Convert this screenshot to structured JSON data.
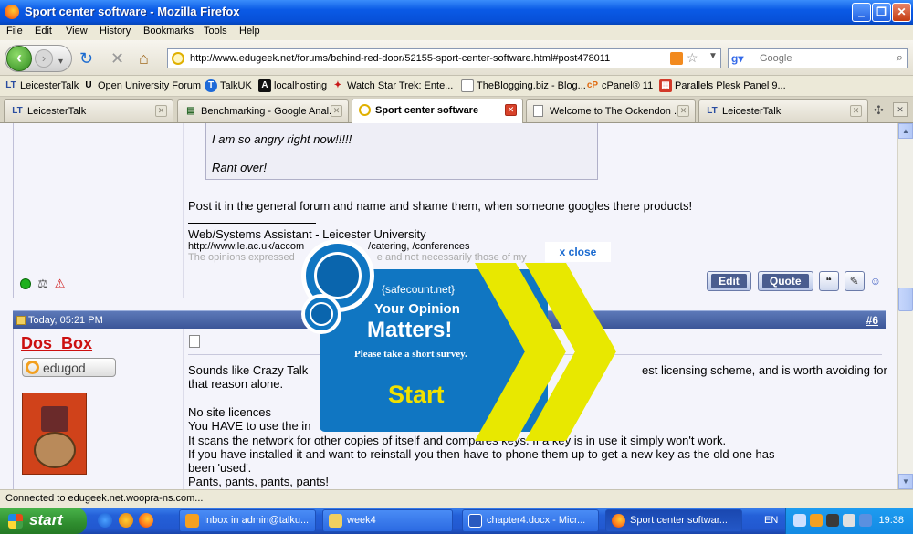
{
  "window": {
    "title": "Sport center software - Mozilla Firefox"
  },
  "menu": [
    "File",
    "Edit",
    "View",
    "History",
    "Bookmarks",
    "Tools",
    "Help"
  ],
  "nav": {
    "url": "http://www.edugeek.net/forums/behind-red-door/52155-sport-center-software.html#post478011",
    "search_placeholder": "Google"
  },
  "bookmarks": [
    {
      "label": "LeicesterTalk",
      "icon": "lt-icon"
    },
    {
      "label": "Open University Forum",
      "icon": "ou-icon"
    },
    {
      "label": "TalkUK",
      "icon": "talkuk-icon"
    },
    {
      "label": "localhosting",
      "icon": "localhosting-icon"
    },
    {
      "label": "Watch Star Trek: Ente...",
      "icon": "startrek-icon"
    },
    {
      "label": "TheBlogging.biz - Blog...",
      "icon": "page-icon"
    },
    {
      "label": "cPanel® 11",
      "icon": "cpanel-icon"
    },
    {
      "label": "Parallels Plesk Panel 9...",
      "icon": "plesk-icon"
    }
  ],
  "tabs": [
    {
      "label": "LeicesterTalk",
      "active": false
    },
    {
      "label": "Benchmarking - Google Anal...",
      "active": false
    },
    {
      "label": "Sport center software",
      "active": true
    },
    {
      "label": "Welcome to The Ockendon ...",
      "active": false
    },
    {
      "label": "LeicesterTalk",
      "active": false
    }
  ],
  "post1": {
    "quote_lines": [
      "I am so angry right now!!!!!",
      "Rant over!"
    ],
    "body": "Post it in the general forum and name and shame them, when someone googles there products!",
    "sig_title": "Web/Systems Assistant - Leicester University",
    "sig_links": "http://www.le.ac.uk/accom",
    "sig_links2": "/catering, /conferences",
    "sig_faded": "The opinions expressed",
    "sig_faded2": "e and not necessarily those of my",
    "buttons": {
      "edit": "Edit",
      "quote": "Quote"
    }
  },
  "post2": {
    "date": "Today, 05:21 PM",
    "number": "#6",
    "username": "Dos_Box",
    "badge": "edugod",
    "lines": [
      "Sounds like Crazy Talk",
      "that reason alone.",
      "No site licences",
      "You HAVE to use the in",
      "It scans the network for other copies of itself and compares keys. If a key is in use it simply won't work.",
      "If you have installed it and want to reinstall you then have to phone them up to get a new key as the old one has",
      "been 'used'.",
      "Pants, pants, pants, pants!"
    ],
    "line1_tail": "est licensing scheme, and is worth avoiding for"
  },
  "survey": {
    "brand": "{safecount.net}",
    "line1": "Your Opinion",
    "line2": "Matters!",
    "line3": "Please take a short survey.",
    "start": "Start",
    "close": "x close",
    "accent": "#1076c2",
    "chevron_color": "#e8e800"
  },
  "status": "Connected to edugeek.net.woopra-ns.com...",
  "taskbar": {
    "start": "start",
    "items": [
      {
        "label": "Inbox in admin@talku...",
        "active": false
      },
      {
        "label": "week4",
        "active": false
      },
      {
        "label": "chapter4.docx - Micr...",
        "active": false
      },
      {
        "label": "Sport center softwar...",
        "active": true
      }
    ],
    "lang": "EN",
    "clock": "19:38"
  }
}
